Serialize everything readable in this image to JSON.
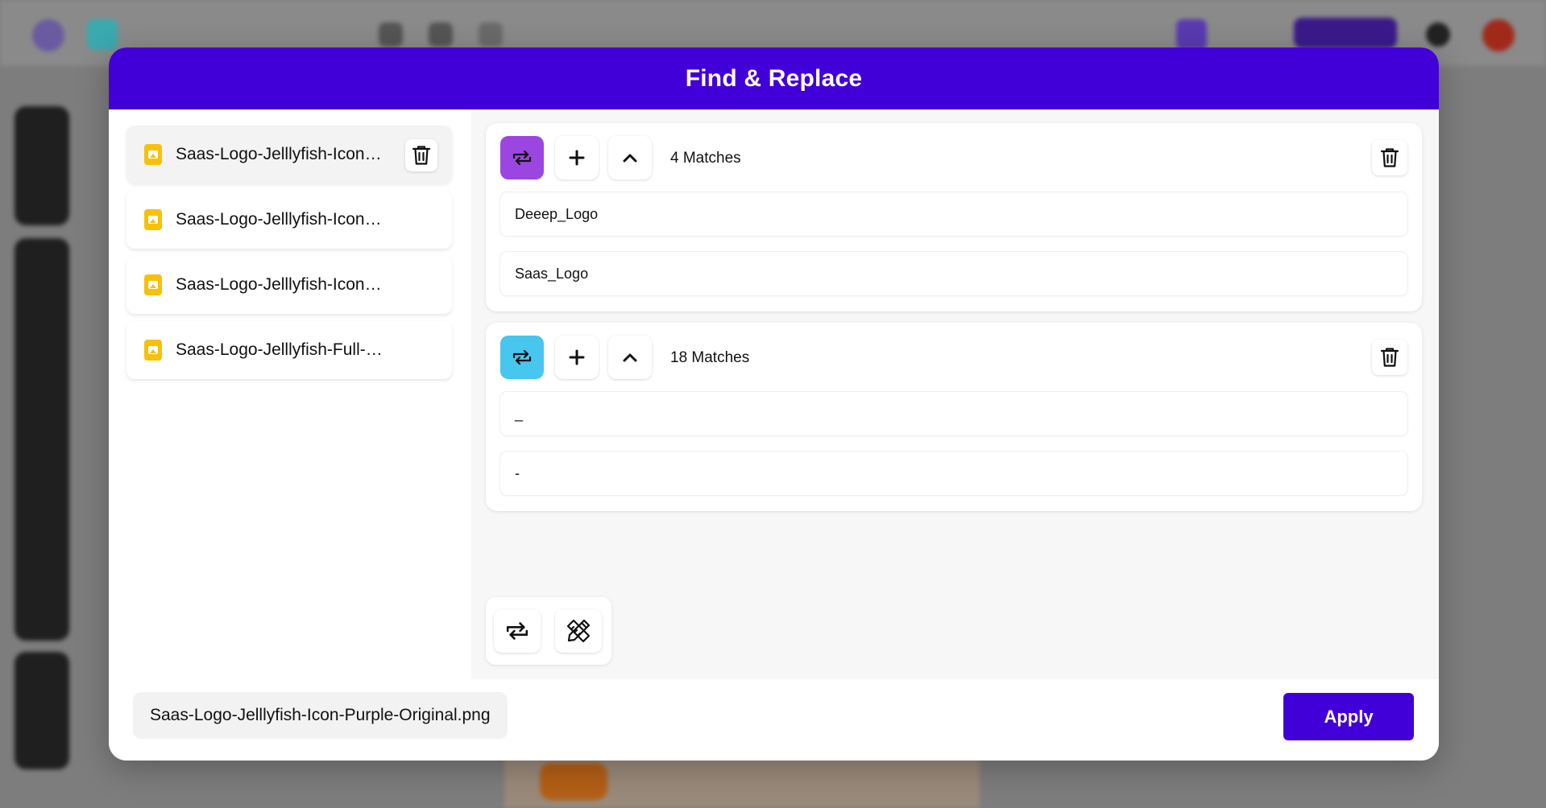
{
  "modal": {
    "title": "Find & Replace"
  },
  "files": [
    {
      "name": "Saas-Logo-Jelllyfish-Icon…",
      "active": true
    },
    {
      "name": "Saas-Logo-Jelllyfish-Icon…",
      "active": false
    },
    {
      "name": "Saas-Logo-Jelllyfish-Icon…",
      "active": false
    },
    {
      "name": "Saas-Logo-Jelllyfish-Full-…",
      "active": false
    }
  ],
  "groups": [
    {
      "matches_label": "4 Matches",
      "find_value": "Deeep_Logo",
      "replace_value": "Saas_Logo",
      "color": "#9b46e0"
    },
    {
      "matches_label": "18 Matches",
      "find_value": "_",
      "replace_value": "-",
      "color": "#47c6ee"
    }
  ],
  "footer": {
    "current_file": "Saas-Logo-Jelllyfish-Icon-Purple-Original.png",
    "apply_label": "Apply"
  },
  "colors": {
    "brand": "#4200d8",
    "group1_accent": "#9b46e0",
    "group2_accent": "#47c6ee",
    "file_icon": "#f7c10a"
  },
  "icons": {
    "group_toggle": "repeat-icon",
    "add": "plus-icon",
    "collapse": "chevron-up-icon",
    "delete": "trash-icon",
    "replace_all": "repeat-icon",
    "design_tools": "design-tools-icon",
    "file": "image-file-icon"
  }
}
